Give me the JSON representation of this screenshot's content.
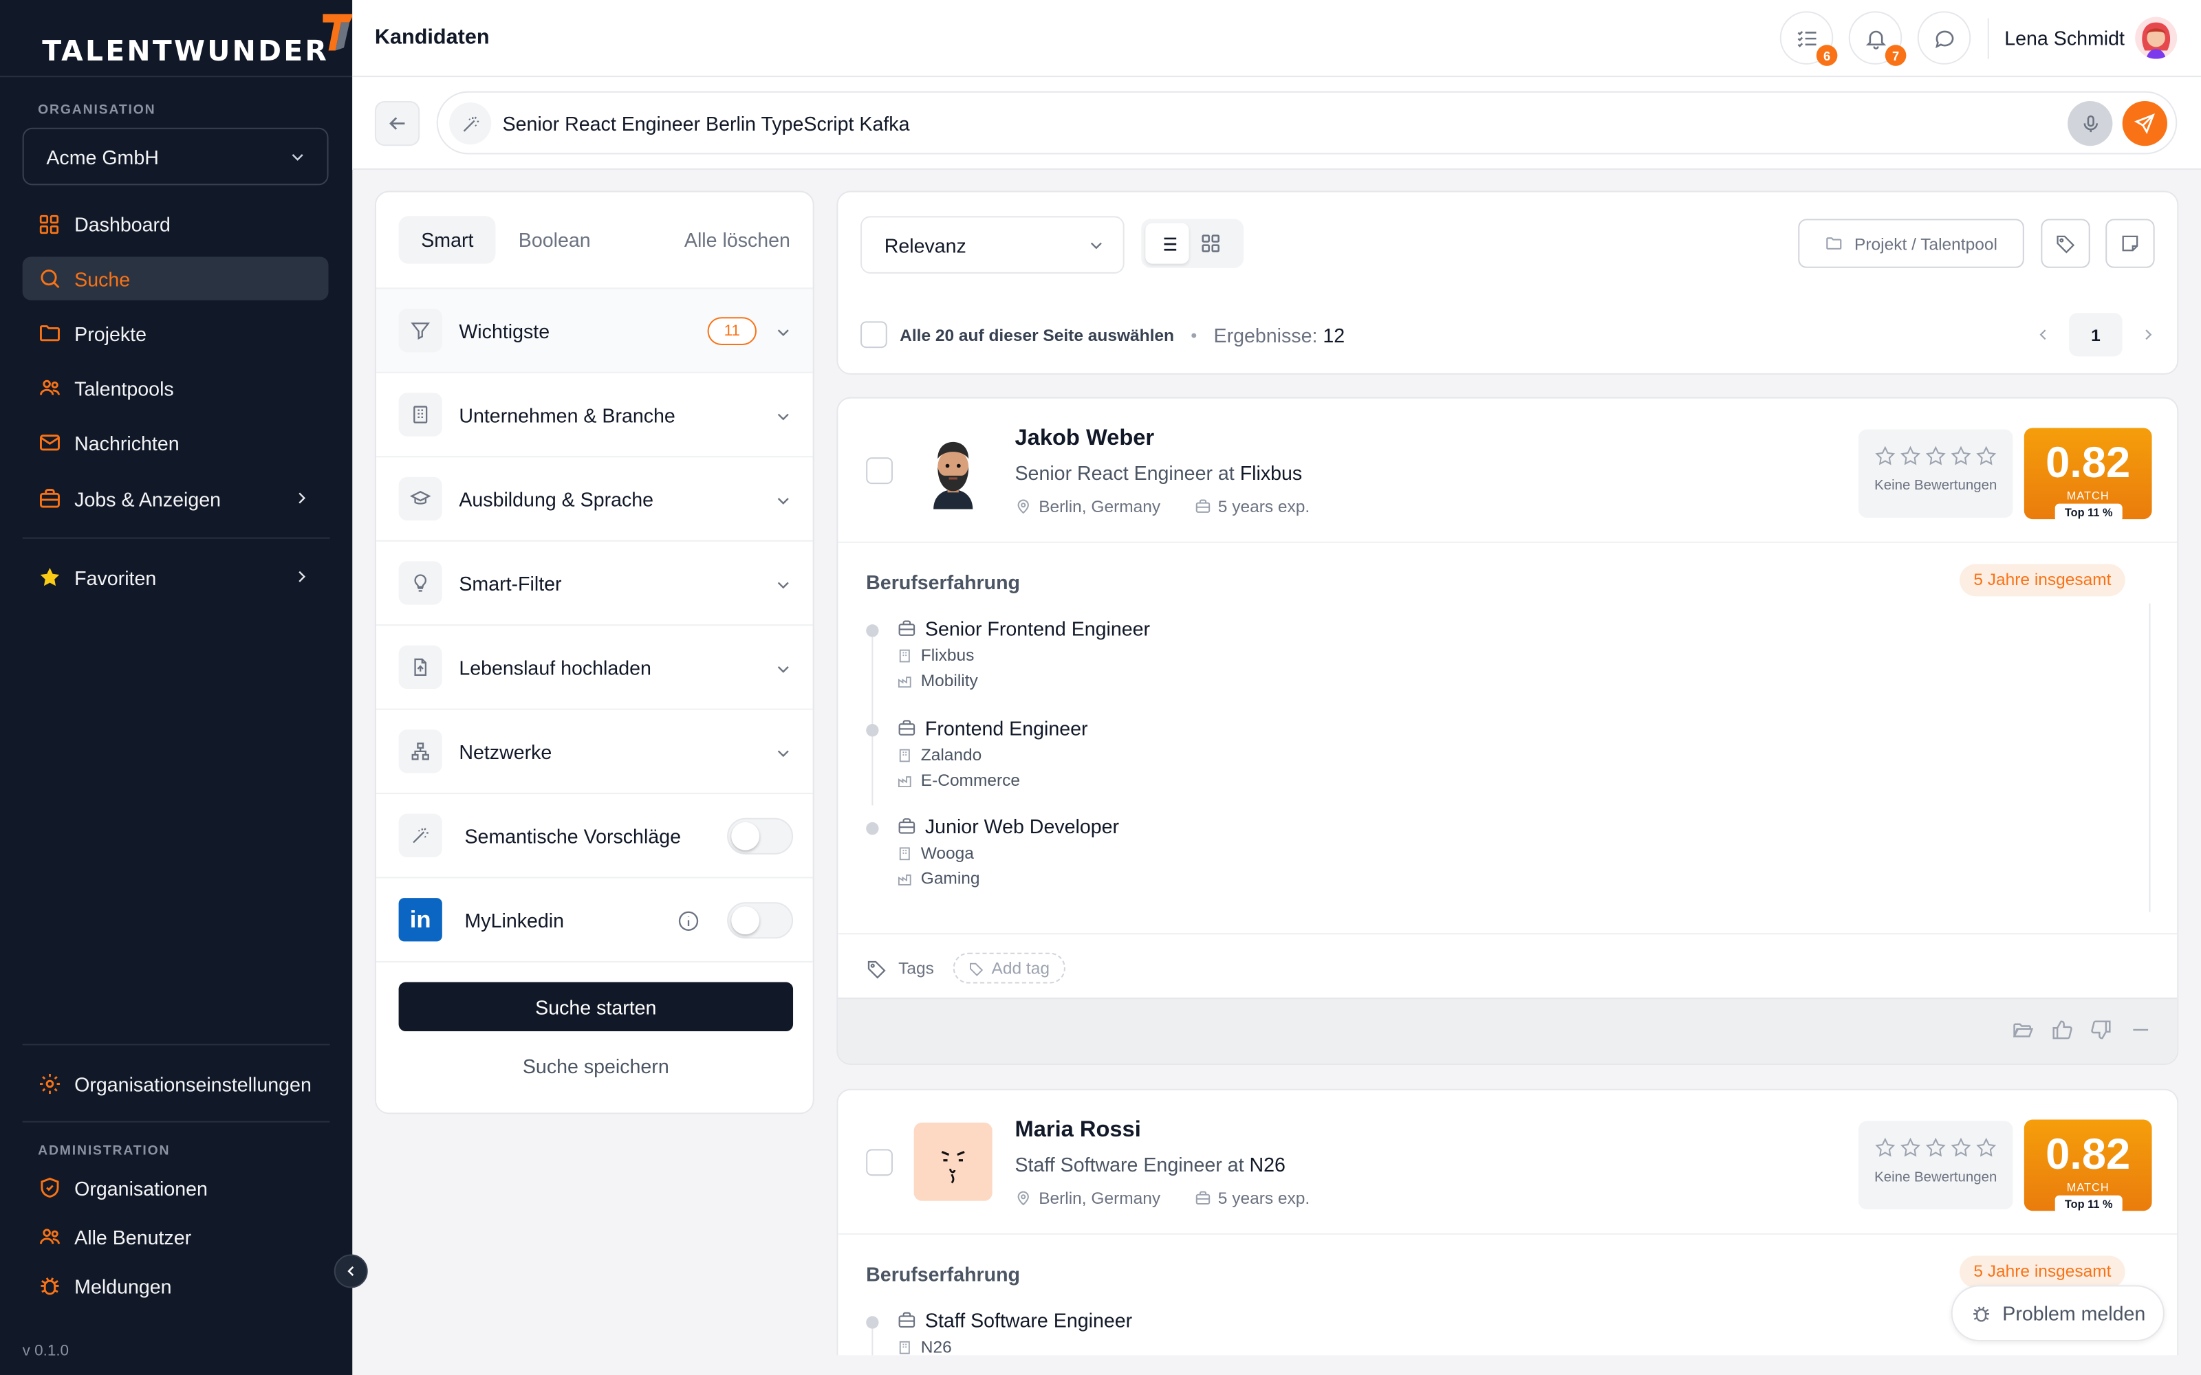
{
  "brand": {
    "name": "TALENTWUNDER",
    "accent": "#f97316",
    "dark": "#111827"
  },
  "sidebar": {
    "org_label": "ORGANISATION",
    "org_value": "Acme GmbH",
    "items": [
      {
        "label": "Dashboard",
        "icon": "grid-icon"
      },
      {
        "label": "Suche",
        "icon": "search-icon",
        "active": true
      },
      {
        "label": "Projekte",
        "icon": "folder-icon"
      },
      {
        "label": "Talentpools",
        "icon": "users-icon"
      },
      {
        "label": "Nachrichten",
        "icon": "mail-icon"
      },
      {
        "label": "Jobs & Anzeigen",
        "icon": "briefcase-icon"
      }
    ],
    "favorites": "Favoriten",
    "org_settings": "Organisationseinstellungen",
    "admin_label": "ADMINISTRATION",
    "admin_items": [
      {
        "label": "Organisationen",
        "icon": "shield-icon"
      },
      {
        "label": "Alle Benutzer",
        "icon": "users-icon"
      },
      {
        "label": "Meldungen",
        "icon": "bug-icon"
      }
    ],
    "version": "v 0.1.0"
  },
  "header": {
    "title": "Kandidaten",
    "tasks_count": "6",
    "notifications_count": "7",
    "user_name": "Lena Schmidt"
  },
  "search": {
    "query": "Senior React Engineer Berlin TypeScript Kafka"
  },
  "filters": {
    "mode_tabs": [
      "Smart",
      "Boolean"
    ],
    "clear_all": "Alle löschen",
    "sections": [
      {
        "label": "Wichtigste",
        "badge": "11",
        "icon": "filter-icon"
      },
      {
        "label": "Unternehmen & Branche",
        "icon": "building-icon"
      },
      {
        "label": "Ausbildung & Sprache",
        "icon": "graduation-cap-icon"
      },
      {
        "label": "Smart-Filter",
        "icon": "lightbulb-icon"
      },
      {
        "label": "Lebenslauf hochladen",
        "icon": "file-upload-icon"
      },
      {
        "label": "Netzwerke",
        "icon": "network-icon"
      }
    ],
    "semantic_label": "Semantische Vorschläge",
    "linkedin_label": "MyLinkedin",
    "linkedin_glyph": "in",
    "start_button": "Suche starten",
    "save_link": "Suche speichern"
  },
  "results": {
    "sort_value": "Relevanz",
    "project_button": "Projekt / Talentpool",
    "select_all": "Alle 20 auf dieser Seite auswählen",
    "results_label": "Ergebnisse:",
    "results_count": "12",
    "page": "1"
  },
  "candidates": [
    {
      "name": "Jakob Weber",
      "role_prefix": "Senior React Engineer at",
      "company": "Flixbus",
      "location": "Berlin, Germany",
      "experience": "5 years exp.",
      "rating_label": "Keine Bewertungen",
      "rating_stars": 0,
      "match": "0.82",
      "match_label": "MATCH",
      "match_rank": "Top 11 %",
      "exp_heading": "Berufserfahrung",
      "exp_total": "5 Jahre insgesamt",
      "jobs": [
        {
          "title": "Senior Frontend Engineer",
          "company": "Flixbus",
          "industry": "Mobility"
        },
        {
          "title": "Frontend Engineer",
          "company": "Zalando",
          "industry": "E-Commerce"
        },
        {
          "title": "Junior Web Developer",
          "company": "Wooga",
          "industry": "Gaming"
        }
      ],
      "tags_label": "Tags",
      "add_tag": "Add tag"
    },
    {
      "name": "Maria Rossi",
      "role_prefix": "Staff Software Engineer at",
      "company": "N26",
      "location": "Berlin, Germany",
      "experience": "5 years exp.",
      "rating_label": "Keine Bewertungen",
      "rating_stars": 0,
      "match": "0.82",
      "match_label": "MATCH",
      "match_rank": "Top 11 %",
      "exp_heading": "Berufserfahrung",
      "exp_total": "5 Jahre insgesamt",
      "jobs": [
        {
          "title": "Staff Software Engineer",
          "company": "N26"
        }
      ]
    }
  ],
  "problem_button": "Problem melden"
}
